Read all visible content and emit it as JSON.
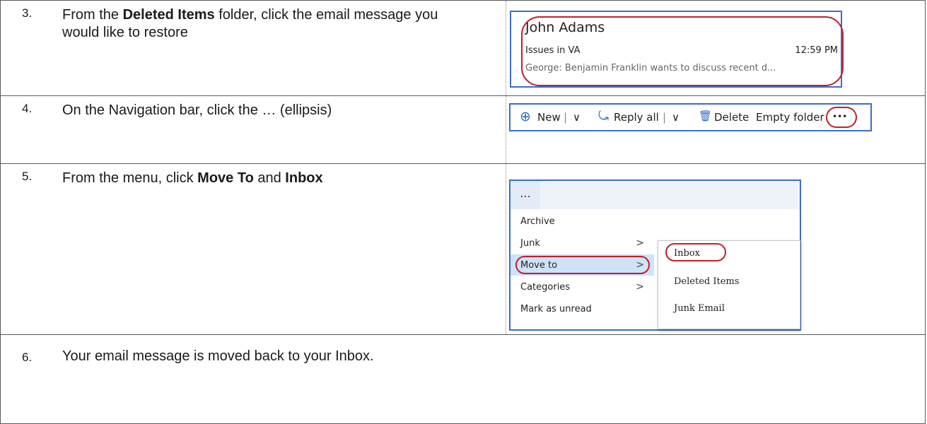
{
  "steps": [
    {
      "number": "3.",
      "text_pre": "From the ",
      "text_bold": "Deleted Items",
      "text_post": " folder, click the  email message you would like to restore"
    },
    {
      "number": "4.",
      "text": "On the Navigation bar, click the … (ellipsis)"
    },
    {
      "number": "5.",
      "text_pre": "From the menu, click ",
      "bold1": "Move To",
      "text_mid": " and ",
      "bold2": "Inbox"
    },
    {
      "number": "6.",
      "text": "Your email message is moved back to your Inbox."
    }
  ],
  "email": {
    "sender": "John Adams",
    "subject": "Issues in VA",
    "time": "12:59 PM",
    "preview": "George:  Benjamin Franklin wants to discuss recent d..."
  },
  "toolbar": {
    "new_icon": "⊕",
    "new_label": "New",
    "sep": "|",
    "chevron": "∨",
    "reply_icon": "⤿",
    "reply_label": "Reply all",
    "delete_icon": "🗑",
    "delete_label": "Delete",
    "empty_label": "Empty folder",
    "more_label": "•••"
  },
  "menu": {
    "more_label": "...",
    "items": [
      {
        "label": "Archive",
        "chevron": ""
      },
      {
        "label": "Junk",
        "chevron": ">"
      },
      {
        "label": "Move to",
        "chevron": ">"
      },
      {
        "label": "Categories",
        "chevron": ">"
      },
      {
        "label": "Mark as unread",
        "chevron": ""
      }
    ],
    "submenu": [
      "Inbox",
      "Deleted Items",
      "Junk Email"
    ]
  },
  "colors": {
    "highlight": "#c0202a",
    "frame": "#3a6fc4",
    "accent": "#2b6cc4"
  }
}
